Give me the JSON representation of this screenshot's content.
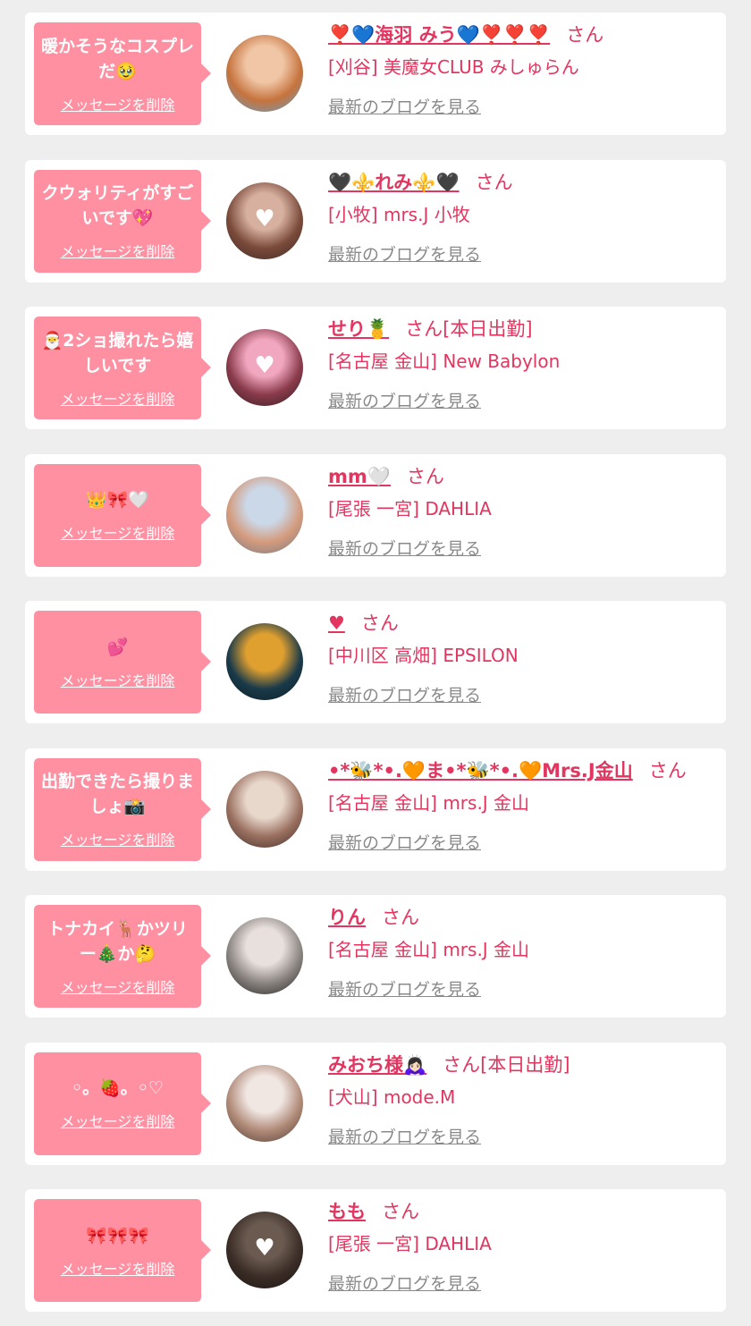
{
  "cards": [
    {
      "message": "暖かそうなコスプレだ🥹",
      "delete_label": "メッセージを削除",
      "name": "❣️💙海羽 みう💙❣️❣️❣️",
      "honorific": "さん",
      "status": "",
      "shop": "[刈谷] 美魔女CLUB みしゅらん",
      "blog_label": "最新のブログを見る",
      "avatar_colors": [
        "#f0c6a6",
        "#c6733d",
        "#5aa3d6"
      ],
      "avatar_overlay": "none"
    },
    {
      "message": "クウォリティがすごいです💖",
      "delete_label": "メッセージを削除",
      "name": "🖤⚜️れみ⚜️🖤",
      "honorific": "さん",
      "status": "",
      "shop": "[小牧] mrs.J 小牧",
      "blog_label": "最新のブログを見る",
      "avatar_colors": [
        "#d7b0a0",
        "#7a4a3a",
        "#3a2a26"
      ],
      "avatar_overlay": "heart"
    },
    {
      "message": "🎅2ショ撮れたら嬉しいです",
      "delete_label": "メッセージを削除",
      "name": "せり🍍",
      "honorific": "さん",
      "status": "[本日出勤]",
      "shop": "[名古屋 金山] New Babylon",
      "blog_label": "最新のブログを見る",
      "avatar_colors": [
        "#f2a7c0",
        "#8a3b4b",
        "#2b1b1f"
      ],
      "avatar_overlay": "heart"
    },
    {
      "message": "👑🎀🤍",
      "delete_label": "メッセージを削除",
      "name": "mm🤍",
      "honorific": "さん",
      "status": "",
      "shop": "[尾張 一宮] DAHLIA",
      "blog_label": "最新のブログを見る",
      "avatar_colors": [
        "#cbd8e8",
        "#d49a7c",
        "#6a7a8a"
      ],
      "avatar_overlay": "none"
    },
    {
      "message": "💕",
      "delete_label": "メッセージを削除",
      "name": "♥",
      "honorific": "さん",
      "status": "",
      "shop": "[中川区 高畑] EPSILON",
      "blog_label": "最新のブログを見る",
      "avatar_colors": [
        "#e0a030",
        "#1a3a4a",
        "#0a1a22"
      ],
      "avatar_overlay": "none"
    },
    {
      "message": "出勤できたら撮りましょ📸",
      "delete_label": "メッセージを削除",
      "name": "•*🐝*•.🧡ま•*🐝*•.🧡Mrs.J金山",
      "honorific": "さん",
      "status": "",
      "shop": "[名古屋 金山] mrs.J 金山",
      "blog_label": "最新のブログを見る",
      "avatar_colors": [
        "#e8d8cc",
        "#9a7060",
        "#3a2a24"
      ],
      "avatar_overlay": "none"
    },
    {
      "message": "トナカイ🦌かツリー🎄か🤔",
      "delete_label": "メッセージを削除",
      "name": "りん",
      "honorific": "さん",
      "status": "",
      "shop": "[名古屋 金山] mrs.J 金山",
      "blog_label": "最新のブログを見る",
      "avatar_colors": [
        "#e8e0dc",
        "#8a8480",
        "#1e1c1c"
      ],
      "avatar_overlay": "none"
    },
    {
      "message": "◦。🍓。◦♡",
      "delete_label": "メッセージを削除",
      "name": "みおち様🙇🏻‍♀️",
      "honorific": "さん",
      "status": "[本日出勤]",
      "shop": "[犬山] mode.M",
      "blog_label": "最新のブログを見る",
      "avatar_colors": [
        "#f0e6e2",
        "#b08a78",
        "#4a3630"
      ],
      "avatar_overlay": "none"
    },
    {
      "message": "🎀🎀🎀",
      "delete_label": "メッセージを削除",
      "name": "もも",
      "honorific": "さん",
      "status": "",
      "shop": "[尾張 一宮] DAHLIA",
      "blog_label": "最新のブログを見る",
      "avatar_colors": [
        "#6a5a50",
        "#3a2c26",
        "#1a1412"
      ],
      "avatar_overlay": "heart"
    }
  ]
}
